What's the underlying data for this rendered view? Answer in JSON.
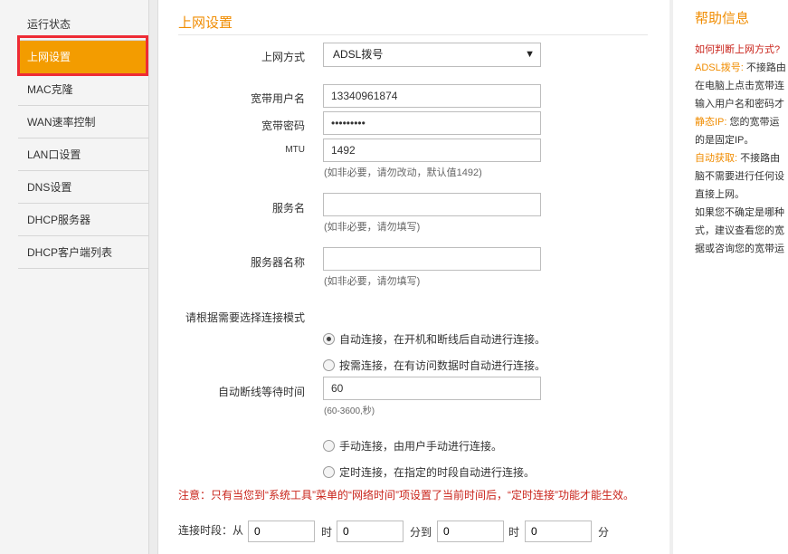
{
  "sidebar": {
    "items": [
      {
        "label": "运行状态"
      },
      {
        "label": "上网设置"
      },
      {
        "label": "MAC克隆"
      },
      {
        "label": "WAN速率控制"
      },
      {
        "label": "LAN口设置"
      },
      {
        "label": "DNS设置"
      },
      {
        "label": "DHCP服务器"
      },
      {
        "label": "DHCP客户端列表"
      }
    ]
  },
  "main": {
    "title": "上网设置",
    "connection_type": {
      "label": "上网方式",
      "value": "ADSL拨号"
    },
    "username": {
      "label": "宽带用户名",
      "value": "13340961874"
    },
    "password": {
      "label": "宽带密码",
      "value": "•••••••••"
    },
    "mtu": {
      "label": "MTU",
      "value": "1492",
      "hint": "(如非必要，请勿改动，默认值1492)"
    },
    "service_name": {
      "label": "服务名",
      "value": "",
      "hint": "(如非必要，请勿填写)"
    },
    "server_name": {
      "label": "服务器名称",
      "value": "",
      "hint": "(如非必要，请勿填写)"
    },
    "mode_label": "请根据需要选择连接模式",
    "modes": {
      "auto": "自动连接，在开机和断线后自动进行连接。",
      "on_demand": "按需连接，在有访问数据时自动进行连接。",
      "manual": "手动连接，由用户手动进行连接。",
      "timed": "定时连接，在指定的时段自动进行连接。"
    },
    "idle_wait": {
      "label": "自动断线等待时间",
      "value": "60",
      "hint": "(60-3600,秒)"
    },
    "note": "注意：只有当您到“系统工具”菜单的“网络时间”项设置了当前时间后，“定时连接”功能才能生效。",
    "schedule": {
      "label": "连接时段：从",
      "start_hour": "0",
      "hour_unit": "时",
      "start_min": "0",
      "to": "分到",
      "end_hour": "0",
      "hour_unit2": "时",
      "end_min": "0",
      "min_unit": "分"
    }
  },
  "help": {
    "title": "帮助信息",
    "lines": [
      {
        "style": "q",
        "text": "如何判断上网方式?"
      },
      {
        "style": "mix",
        "key": "ADSL拨号: ",
        "text": "不接路由"
      },
      {
        "style": "n",
        "text": "在电脑上点击宽带连"
      },
      {
        "style": "n",
        "text": "输入用户名和密码才"
      },
      {
        "style": "mix",
        "key": "静态IP: ",
        "text": "您的宽带运"
      },
      {
        "style": "n",
        "text": "的是固定IP。"
      },
      {
        "style": "mix",
        "key": "自动获取: ",
        "text": "不接路由"
      },
      {
        "style": "n",
        "text": "脑不需要进行任何设"
      },
      {
        "style": "n",
        "text": "直接上网。"
      },
      {
        "style": "n",
        "text": "如果您不确定是哪种"
      },
      {
        "style": "n",
        "text": "式，建议查看您的宽"
      },
      {
        "style": "n",
        "text": "据或咨询您的宽带运"
      }
    ]
  }
}
